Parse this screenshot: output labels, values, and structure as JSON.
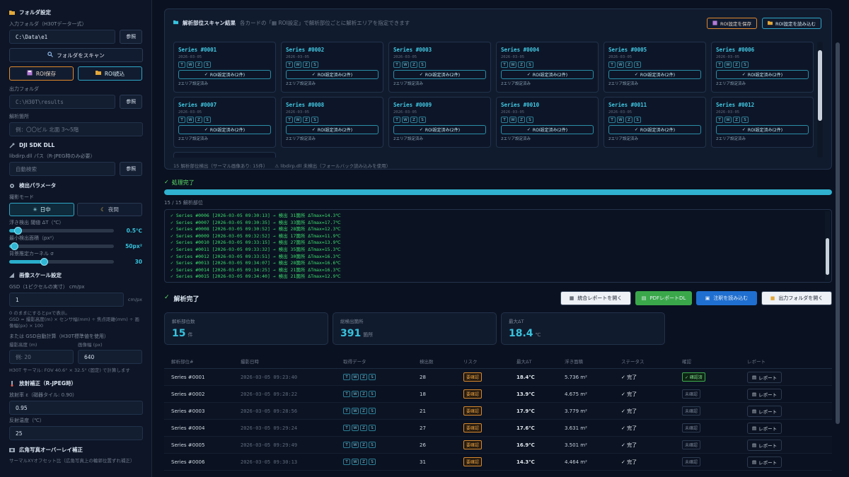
{
  "sidebar": {
    "folder": {
      "title": "フォルダ設定",
      "input_label": "入力フォルダ（H30Tデータ一式）",
      "input_value": "C:\\Data\\e1",
      "browse": "参照",
      "scan_button": "フォルダをスキャン",
      "roi_save": "ROI保存",
      "roi_load": "ROI読込",
      "output_label": "出力フォルダ",
      "output_value": "C:\\H30T\\results",
      "location_label": "解析箇所",
      "location_placeholder": "例：〇〇ビル 北面 3〜5階"
    },
    "dll": {
      "title": "DJI SDK DLL",
      "path_label": "libdirp.dll パス（R-JPEG時のみ必要）",
      "path_value": "自動検索",
      "browse": "参照"
    },
    "detect": {
      "title": "検出パラメータ",
      "mode_label": "撮影モード",
      "mode_day": "日中",
      "mode_night": "夜間",
      "threshold_label": "浮き検出 閾値 ΔT（℃）",
      "threshold_value": "0.5℃",
      "threshold_fraction": 0.08,
      "minarea_label": "最小検出面積（px²）",
      "minarea_value": "50px²",
      "minarea_fraction": 0.05,
      "kernel_label": "背景推定カーネル σ",
      "kernel_value": "30",
      "kernel_fraction": 0.33
    },
    "scale": {
      "title": "画像スケール設定",
      "gsd_label": "GSD（1ピクセルの実寸） cm/px",
      "gsd_value": "1",
      "gsd_unit": "cm/px",
      "note1": "0 のままにするとpxで表示。",
      "note2": "GSD = 撮影高度(m) × センサ幅(mm) ÷ 焦点距離(mm) ÷ 画像幅(px) × 100",
      "auto_label": "または GSD自動計算（H30T標準値を使用）",
      "height_label": "撮影高度 (m)",
      "width_label": "画像幅 (px)",
      "height_placeholder": "例: 20",
      "width_value": "640",
      "fov_note": "H30T サーマル: FOV 40.6° × 32.5° (固定) で計算します"
    },
    "emissivity": {
      "title": "放射補正（R-JPEG時）",
      "emis_label": "放射率 ε（磁器タイル: 0.90）",
      "emis_value": "0.95",
      "refl_label": "反射温度（℃）",
      "refl_value": "25"
    },
    "overlay": {
      "title": "広角写真オーバーレイ補正",
      "offset_label": "サーマルXYオフセット比（広角写真上の輪郭位置ずれ補正）"
    }
  },
  "scan": {
    "title": "解析部位スキャン結果",
    "subtitle": "各カードの「▦ ROI設定」で解析部位ごとに解析エリアを指定できます",
    "save_roi": "ROI設定を保存",
    "load_roi": "ROI設定を読み込む",
    "footer_count": "15 解析部位検出（サーマル画像あり: 15件）",
    "footer_dll": "⚠ libdirp.dll 未検出（フォールバック読み込みを使用）",
    "chips": [
      "T",
      "W",
      "Z",
      "S"
    ],
    "roi_label": "ROI設定済み(2件)",
    "roi_sub": "2エリア設定済み",
    "cards": [
      {
        "name": "Series #0001",
        "date": "2026-03-05"
      },
      {
        "name": "Series #0002",
        "date": "2026-03-05"
      },
      {
        "name": "Series #0003",
        "date": "2026-03-05"
      },
      {
        "name": "Series #0004",
        "date": "2026-03-05"
      },
      {
        "name": "Series #0005",
        "date": "2026-03-05"
      },
      {
        "name": "Series #0006",
        "date": "2026-03-05"
      },
      {
        "name": "Series #0007",
        "date": "2026-03-05"
      },
      {
        "name": "Series #0008",
        "date": "2026-03-05"
      },
      {
        "name": "Series #0009",
        "date": "2026-03-05"
      },
      {
        "name": "Series #0010",
        "date": "2026-03-05"
      },
      {
        "name": "Series #0011",
        "date": "2026-03-05"
      },
      {
        "name": "Series #0012",
        "date": "2026-03-05"
      }
    ]
  },
  "process": {
    "title": "処理完了",
    "progress_fraction": 1.0,
    "count": "15 / 15 解析部位",
    "log": [
      "✓ Series #0006 [2026-03-05 09:30:13] → 検出 31箇所 ΔTmax=14.3℃",
      "✓ Series #0007 [2026-03-05 09:30:35] → 検出 33箇所 ΔTmax=17.7℃",
      "✓ Series #0008 [2026-03-05 09:30:52] → 検出 28箇所 ΔTmax=12.3℃",
      "✓ Series #0009 [2026-03-05 09:32:52] → 検出 17箇所 ΔTmax=11.9℃",
      "✓ Series #0010 [2026-03-05 09:33:15] → 検出 27箇所 ΔTmax=13.9℃",
      "✓ Series #0011 [2026-03-05 09:33:32] → 検出 35箇所 ΔTmax=15.3℃",
      "✓ Series #0012 [2026-03-05 09:33:51] → 検出 30箇所 ΔTmax=16.3℃",
      "✓ Series #0013 [2026-03-05 09:34:07] → 検出 28箇所 ΔTmax=16.6℃",
      "✓ Series #0014 [2026-03-05 09:34:25] → 検出 21箇所 ΔTmax=16.3℃",
      "✓ Series #0015 [2026-03-05 09:34:40] → 検出 21箇所 ΔTmax=12.9℃"
    ]
  },
  "results": {
    "title": "解析完了",
    "btn_report": "統合レポートを開く",
    "btn_pdf": "PDFレポートDL",
    "btn_notes": "注釈を読み込む",
    "btn_output": "出力フォルダを開く",
    "stats": [
      {
        "label": "解析部位数",
        "value": "15",
        "unit": "件"
      },
      {
        "label": "総検出箇所",
        "value": "391",
        "unit": "箇所"
      },
      {
        "label": "最大ΔT",
        "value": "18.4",
        "unit": "℃"
      }
    ],
    "headers": [
      "解析部位#",
      "撮影日時",
      "取得データ",
      "検出数",
      "リスク",
      "最大ΔT",
      "浮き面積",
      "ステータス",
      "確認",
      "レポート"
    ],
    "rows": [
      {
        "id": "Series #0001",
        "time": "2026-03-05 09:23:40",
        "count": "28",
        "risk": "要確認",
        "dt": "18.4℃",
        "area": "5.736 m²",
        "status": "✓ 完了",
        "confirm": "✓ 確認済",
        "confirmed": true,
        "report": "レポート"
      },
      {
        "id": "Series #0002",
        "time": "2026-03-05 09:28:22",
        "count": "18",
        "risk": "要確認",
        "dt": "13.9℃",
        "area": "4.675 m²",
        "status": "✓ 完了",
        "confirm": "未確認",
        "confirmed": false,
        "report": "レポート"
      },
      {
        "id": "Series #0003",
        "time": "2026-03-05 09:28:56",
        "count": "21",
        "risk": "要確認",
        "dt": "17.9℃",
        "area": "3.779 m²",
        "status": "✓ 完了",
        "confirm": "未確認",
        "confirmed": false,
        "report": "レポート"
      },
      {
        "id": "Series #0004",
        "time": "2026-03-05 09:29:24",
        "count": "27",
        "risk": "要確認",
        "dt": "17.6℃",
        "area": "3.631 m²",
        "status": "✓ 完了",
        "confirm": "未確認",
        "confirmed": false,
        "report": "レポート"
      },
      {
        "id": "Series #0005",
        "time": "2026-03-05 09:29:49",
        "count": "26",
        "risk": "要確認",
        "dt": "16.9℃",
        "area": "3.501 m²",
        "status": "✓ 完了",
        "confirm": "未確認",
        "confirmed": false,
        "report": "レポート"
      },
      {
        "id": "Series #0006",
        "time": "2026-03-05 09:30:13",
        "count": "31",
        "risk": "要確認",
        "dt": "14.3℃",
        "area": "4.464 m²",
        "status": "✓ 完了",
        "confirm": "未確認",
        "confirmed": false,
        "report": "レポート"
      }
    ]
  },
  "colors": {
    "accent": "#2fb1cf",
    "success": "#5ee06a",
    "warning": "#e28a2e",
    "pdf_button": "#3aa84a",
    "notes_button": "#1f6fd0"
  }
}
